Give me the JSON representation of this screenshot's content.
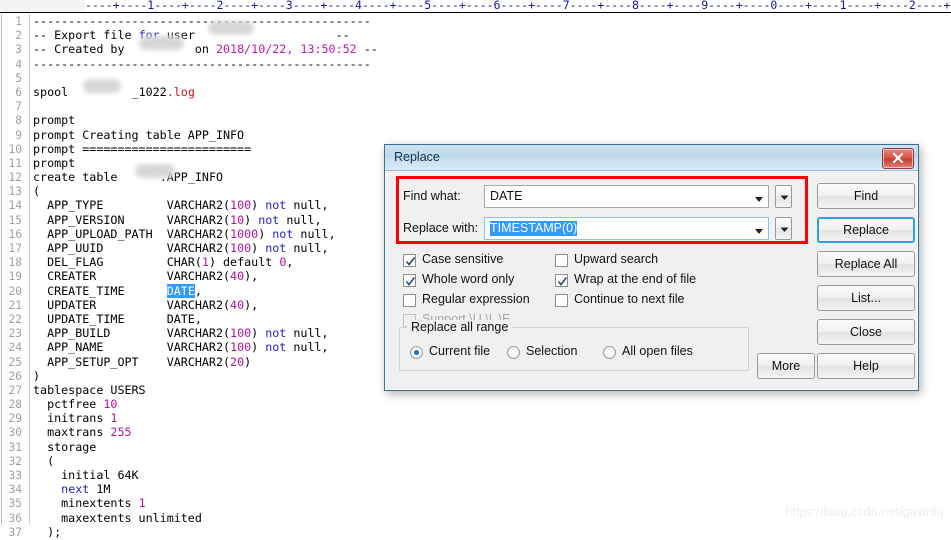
{
  "editor": {
    "ruler_text": "----+----1----+----2----+----3----+----4----+----5----+----6----+----7----+----8----+----9----+----0----+----1----+----2----+--",
    "lines": [
      {
        "n": "1",
        "text": "------------------------------------------------"
      },
      {
        "n": "2",
        "text": "-- Export file for user"
      },
      {
        "n": "3",
        "text": "-- Created by"
      },
      {
        "n": "4",
        "text": "------------------------------------------------"
      },
      {
        "n": "5",
        "text": ""
      },
      {
        "n": "6",
        "text": "spool"
      },
      {
        "n": "7",
        "text": ""
      },
      {
        "n": "8",
        "text": "prompt"
      },
      {
        "n": "9",
        "text": "prompt Creating table APP_INFO"
      },
      {
        "n": "10",
        "text": "prompt ========================"
      },
      {
        "n": "11",
        "text": "prompt"
      },
      {
        "n": "12",
        "text": "create table"
      },
      {
        "n": "13",
        "text": "("
      },
      {
        "n": "14",
        "text": "  APP_TYPE         VARCHAR2(100) not null,"
      },
      {
        "n": "15",
        "text": "  APP_VERSION      VARCHAR2(10) not null,"
      },
      {
        "n": "16",
        "text": "  APP_UPLOAD_PATH  VARCHAR2(1000) not null,"
      },
      {
        "n": "17",
        "text": "  APP_UUID         VARCHAR2(100) not null,"
      },
      {
        "n": "18",
        "text": "  DEL_FLAG         CHAR(1) default 0,"
      },
      {
        "n": "19",
        "text": "  CREATER          VARCHAR2(40),"
      },
      {
        "n": "20",
        "text": "  CREATE_TIME      DATE,"
      },
      {
        "n": "21",
        "text": "  UPDATER          VARCHAR2(40),"
      },
      {
        "n": "22",
        "text": "  UPDATE_TIME      DATE,"
      },
      {
        "n": "23",
        "text": "  APP_BUILD        VARCHAR2(100) not null,"
      },
      {
        "n": "24",
        "text": "  APP_NAME         VARCHAR2(100) not null,"
      },
      {
        "n": "25",
        "text": "  APP_SETUP_OPT    VARCHAR2(20)"
      },
      {
        "n": "26",
        "text": ")"
      },
      {
        "n": "27",
        "text": "tablespace USERS"
      },
      {
        "n": "28",
        "text": "  pctfree 10"
      },
      {
        "n": "29",
        "text": "  initrans 1"
      },
      {
        "n": "30",
        "text": "  maxtrans 255"
      },
      {
        "n": "31",
        "text": "  storage"
      },
      {
        "n": "32",
        "text": "  ("
      },
      {
        "n": "33",
        "text": "    initial 64K"
      },
      {
        "n": "34",
        "text": "    next 1M"
      },
      {
        "n": "35",
        "text": "    minextents 1"
      },
      {
        "n": "36",
        "text": "    maxextents unlimited"
      },
      {
        "n": "37",
        "text": "  );"
      }
    ],
    "tokens": {
      "dashes": "------------------------------------------------",
      "comment_export": "-- Export file ",
      "kw_for": "for",
      "user_word": " user",
      "trailing_dashes": "                    --",
      "comment_created": "-- Created by",
      "on_word": "  on ",
      "datetime": "2018/10/22, 13:50:52",
      "created_tail": " --",
      "spool_kw": "spool ",
      "spool_name_tail": "_1022.log",
      "spool_log_ext": ".log",
      "spool_name_mid": "_1022",
      "prompt": "prompt",
      "prompt_creating": "prompt Creating table APP_INFO",
      "prompt_equals": "prompt ========================",
      "create_table": "create table",
      "schema_suffix": ".APP_INFO",
      "open_paren": "(",
      "selected_date": "DATE",
      "comma": ","
    },
    "watermark": "https://blog.csdn.net/gavinbj"
  },
  "dialog": {
    "title": "Replace",
    "close_icon": "close-icon",
    "find_label": "Find what:",
    "find_value": "DATE",
    "replace_label": "Replace with:",
    "replace_value": "TIMESTAMP(0)",
    "checkboxes": [
      {
        "label": "Case sensitive",
        "checked": true,
        "disabled": false
      },
      {
        "label": "Whole word only",
        "checked": true,
        "disabled": false
      },
      {
        "label": "Regular expression",
        "checked": false,
        "disabled": false
      },
      {
        "label": "Support \\U \\L \\E",
        "checked": false,
        "disabled": true
      },
      {
        "label": "Upward search",
        "checked": false,
        "disabled": false
      },
      {
        "label": "Wrap at the end of file",
        "checked": true,
        "disabled": false
      },
      {
        "label": "Continue to next file",
        "checked": false,
        "disabled": false
      }
    ],
    "group_label": "Replace all range",
    "radios": [
      {
        "label": "Current file",
        "selected": true
      },
      {
        "label": "Selection",
        "selected": false
      },
      {
        "label": "All open files",
        "selected": false
      }
    ],
    "buttons": [
      {
        "label": "Find",
        "default": false
      },
      {
        "label": "Replace",
        "default": true
      },
      {
        "label": "Replace All",
        "default": false
      },
      {
        "label": "List...",
        "default": false
      },
      {
        "label": "Close",
        "default": false
      },
      {
        "label": "More",
        "default": false
      },
      {
        "label": "Help",
        "default": false
      }
    ],
    "accent_color": "#2e9fe0",
    "annotation_color": "#ff0000"
  }
}
